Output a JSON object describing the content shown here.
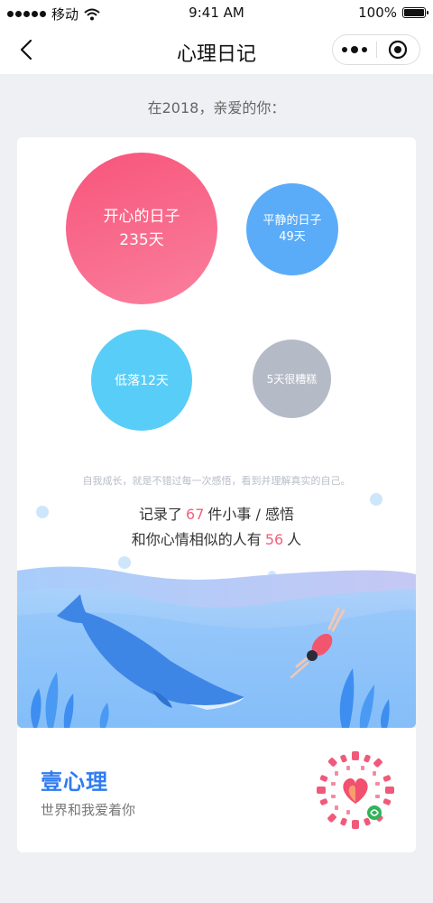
{
  "status_bar": {
    "carrier": "移动",
    "time": "9:41 AM",
    "battery": "100%"
  },
  "nav": {
    "title": "心理日记"
  },
  "greeting": "在2018，亲爱的你：",
  "moods": {
    "happy": {
      "label": "开心的日子",
      "count": "235天",
      "color": "#f7557a"
    },
    "calm": {
      "label": "平静的日子",
      "count": "49天",
      "color": "#5aacf8"
    },
    "low": {
      "label": "低落12天",
      "color": "#58cdf7"
    },
    "bad": {
      "label": "5天很糟糕",
      "color": "#b4bac6"
    }
  },
  "motto": "自我成长，就是不错过每一次感悟，看到并理解真实的自己。",
  "stats": {
    "line1_prefix": "记录了",
    "records": "67",
    "line1_suffix": "件小事 / 感悟",
    "line2_prefix": "和你心情相似的人有",
    "similar": "56",
    "line2_suffix": "人",
    "highlight_color": "#f3607e"
  },
  "footer": {
    "brand": "壹心理",
    "slogan": "世界和我爱着你",
    "brand_color": "#2f7cf0"
  },
  "icons": [
    "signal-icon",
    "wifi-icon",
    "battery-icon",
    "back-arrow-icon",
    "more-icon",
    "close-target-icon",
    "whale-illustration",
    "swimmer-illustration",
    "mini-program-code"
  ]
}
